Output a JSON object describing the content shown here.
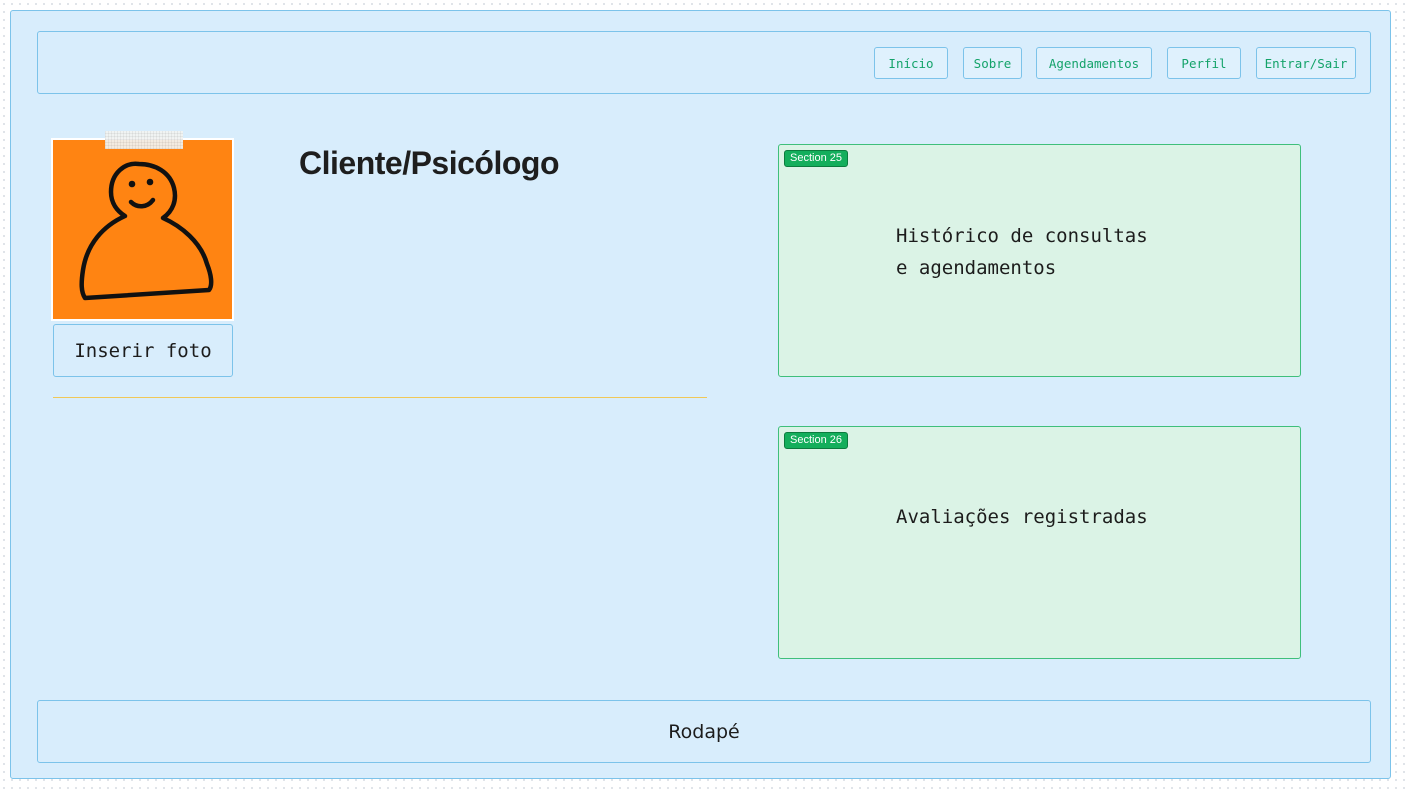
{
  "nav": {
    "items": [
      {
        "label": "Início"
      },
      {
        "label": "Sobre"
      },
      {
        "label": "Agendamentos"
      },
      {
        "label": "Perfil"
      },
      {
        "label": "Entrar/Sair"
      }
    ]
  },
  "profile": {
    "title": "Cliente/Psicólogo",
    "photo_button_label": "Inserir foto",
    "avatar_icon": "person-doodle-icon"
  },
  "sections": [
    {
      "tag": "Section 25",
      "lines": [
        "Histórico de consultas",
        "e agendamentos"
      ]
    },
    {
      "tag": "Section 26",
      "lines": [
        "Avaliações registradas"
      ]
    }
  ],
  "footer": {
    "label": "Rodapé"
  },
  "colors": {
    "frame_bg": "#d8edfc",
    "frame_border": "#7cc3ea",
    "nav_text": "#14a36a",
    "avatar_bg": "#ff8412",
    "section_bg": "#dbf3e6",
    "section_tag": "#14ae5c",
    "divider": "#f0c857"
  }
}
